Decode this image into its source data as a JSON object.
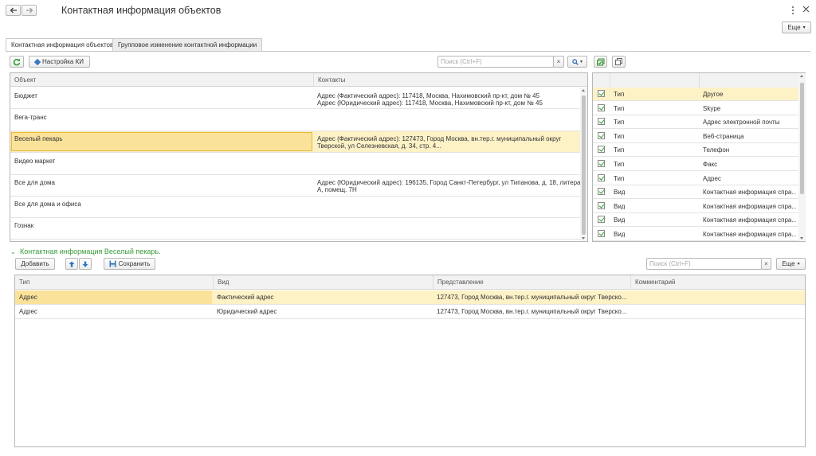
{
  "window": {
    "title": "Контактная информация объектов",
    "more_label": "Еще"
  },
  "tabs": [
    {
      "label": "Контактная информация объектов"
    },
    {
      "label": "Групповое изменение контактной информации"
    }
  ],
  "toolbar": {
    "settings_label": "Настройка КИ",
    "search_placeholder": "Поиск (Ctrl+F)"
  },
  "objects_grid": {
    "columns": [
      "Объект",
      "Контакты"
    ],
    "rows": [
      {
        "object": "Бюджет",
        "contacts": [
          "Адрес (Фактический адрес): 117418, Москва, Нахимовский пр-кт, дом № 45",
          "Адрес (Юридический адрес): 117418, Москва, Нахимовский пр-кт, дом № 45"
        ]
      },
      {
        "object": "Вега-транс",
        "contacts": [
          "",
          ""
        ]
      },
      {
        "object": "Веселый пекарь",
        "contacts": [
          "Адрес (Фактический адрес): 127473, Город Москва, вн.тер.г. муниципальный округ",
          "Тверской, ул Селезневская, д. 34, стр. 4..."
        ]
      },
      {
        "object": "Видео маркет",
        "contacts": [
          "",
          ""
        ]
      },
      {
        "object": "Все для дома",
        "contacts": [
          "Адрес (Юридический адрес): 196135, Город Санкт-Петербург, ул Типанова, д. 18, литера",
          "А, помещ. 7Н"
        ]
      },
      {
        "object": "Все для дома и офиса",
        "contacts": [
          "",
          ""
        ]
      },
      {
        "object": "Гознак",
        "contacts": [
          "",
          ""
        ]
      }
    ]
  },
  "types_grid": {
    "rows": [
      {
        "kind": "Тип",
        "name": "Другое"
      },
      {
        "kind": "Тип",
        "name": "Skype"
      },
      {
        "kind": "Тип",
        "name": "Адрес электронной почты"
      },
      {
        "kind": "Тип",
        "name": "Веб-страница"
      },
      {
        "kind": "Тип",
        "name": "Телефон"
      },
      {
        "kind": "Тип",
        "name": "Факс"
      },
      {
        "kind": "Тип",
        "name": "Адрес"
      },
      {
        "kind": "Вид",
        "name": "Контактная информация спра..."
      },
      {
        "kind": "Вид",
        "name": "Контактная информация спра..."
      },
      {
        "kind": "Вид",
        "name": "Контактная информация спра..."
      },
      {
        "kind": "Вид",
        "name": "Контактная информация спра..."
      }
    ]
  },
  "details": {
    "title": "Контактная информация Веселый пекарь.",
    "add_label": "Добавить",
    "save_label": "Сохранить",
    "search_placeholder": "Поиск (Ctrl+F)",
    "more_label": "Еще",
    "columns": [
      "Тип",
      "Вид",
      "Представление",
      "Комментарий"
    ],
    "rows": [
      {
        "type": "Адрес",
        "kind": "Фактический адрес",
        "repr": "127473, Город Москва, вн.тер.г. муниципальный округ Тверско...",
        "comment": ""
      },
      {
        "type": "Адрес",
        "kind": "Юридический адрес",
        "repr": "127473, Город Москва, вн.тер.г. муниципальный округ Тверско...",
        "comment": ""
      }
    ]
  },
  "colors": {
    "accent_green": "#3a9a3a",
    "selection": "#fdf1c6"
  }
}
